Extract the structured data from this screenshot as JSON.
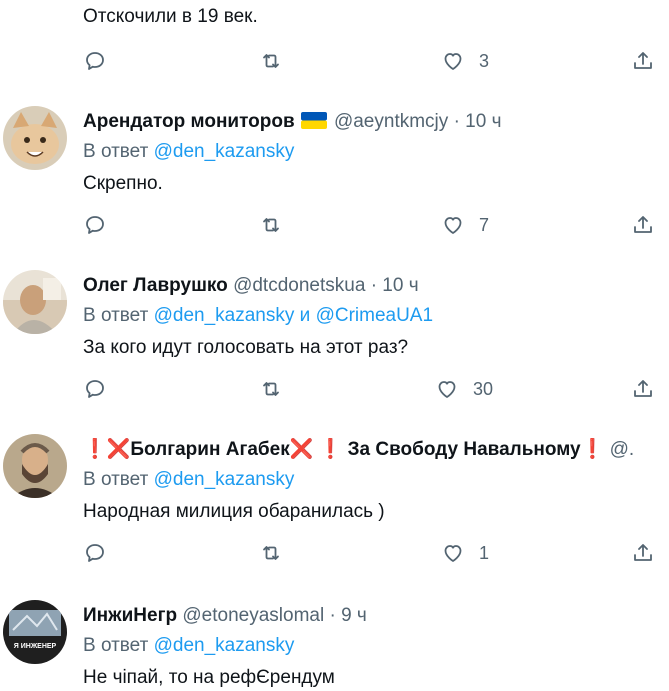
{
  "tweets": [
    {
      "text": "Отскочили в 19 век.",
      "likes": "3"
    },
    {
      "name": "Арендатор мониторов",
      "handle": "@aeyntkmcjy",
      "time": "10 ч",
      "reply_prefix": "В ответ",
      "mention1": "@den_kazansky",
      "text": "Скрепно.",
      "likes": "7",
      "flag_colors": [
        "#0057b7",
        "#ffd700"
      ]
    },
    {
      "name": "Олег Лаврушко",
      "handle": "@dtcdonetskua",
      "time": "10 ч",
      "reply_prefix": "В ответ",
      "mention1": "@den_kazansky",
      "conj": "и",
      "mention2": "@CrimeaUA1",
      "text": "За кого идут голосовать на этот раз?",
      "likes": "30"
    },
    {
      "name_ex1": "❗",
      "name_x1": "❌",
      "name_main": "Болгарин Агабек",
      "name_x2": "❌",
      "name_ex2": "❗",
      "name_tail": "За Свободу Навальному",
      "name_ex3": "❗",
      "handle": "@.",
      "reply_prefix": "В ответ",
      "mention1": "@den_kazansky",
      "text": "Народная милиция обаранилась )",
      "likes": "1"
    },
    {
      "name": "ИнжиНегр",
      "handle": "@etoneyaslomal",
      "time": "9 ч",
      "reply_prefix": "В ответ",
      "mention1": "@den_kazansky",
      "text": "Не чіпай, то на рефЄрендум",
      "avatar_label": "Я ИНЖЕНЕР"
    }
  ],
  "colors": {
    "accent": "#1d9bf0",
    "secondary_text": "#536471",
    "icon": "#536471",
    "divider": "#eff3f4"
  }
}
